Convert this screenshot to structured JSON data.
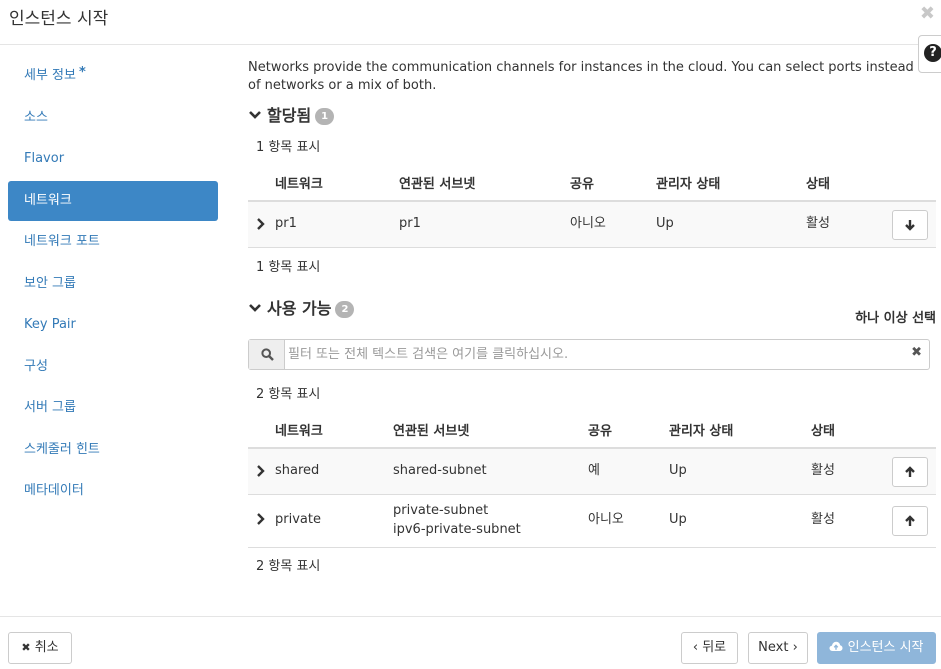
{
  "modal": {
    "title": "인스턴스 시작",
    "close_icon": "close-icon",
    "help_glyph": "?"
  },
  "sidebar": {
    "items": [
      {
        "label": "세부 정보",
        "required": "*"
      },
      {
        "label": "소스"
      },
      {
        "label": "Flavor"
      },
      {
        "label": "네트워크",
        "active": true
      },
      {
        "label": "네트워크 포트"
      },
      {
        "label": "보안 그룹"
      },
      {
        "label": "Key Pair"
      },
      {
        "label": "구성"
      },
      {
        "label": "서버 그룹"
      },
      {
        "label": "스케줄러 힌트"
      },
      {
        "label": "메타데이터"
      }
    ]
  },
  "description": "Networks provide the communication channels for instances in the cloud. You can select ports instead of networks or a mix of both.",
  "allocated": {
    "title": "할당됨",
    "badge": "1",
    "count_top": "1 항목 표시",
    "count_bottom": "1 항목 표시",
    "columns": [
      "네트워크",
      "연관된 서브넷",
      "공유",
      "관리자 상태",
      "상태"
    ],
    "rows": [
      {
        "network": "pr1",
        "subnets": [
          "pr1"
        ],
        "shared": "아니오",
        "admin_state": "Up",
        "status": "활성"
      }
    ]
  },
  "available": {
    "title": "사용 가능",
    "badge": "2",
    "select_hint": "하나 이상 선택",
    "search_placeholder": "필터 또는 전체 텍스트 검색은 여기를 클릭하십시오.",
    "count_top": "2 항목 표시",
    "count_bottom": "2 항목 표시",
    "columns": [
      "네트워크",
      "연관된 서브넷",
      "공유",
      "관리자 상태",
      "상태"
    ],
    "rows": [
      {
        "network": "shared",
        "subnets": [
          "shared-subnet"
        ],
        "shared": "예",
        "admin_state": "Up",
        "status": "활성"
      },
      {
        "network": "private",
        "subnets": [
          "private-subnet",
          "ipv6-private-subnet"
        ],
        "shared": "아니오",
        "admin_state": "Up",
        "status": "활성"
      }
    ]
  },
  "footer": {
    "cancel": "취소",
    "back": "뒤로",
    "next": "Next",
    "launch": "인스턴스 시작"
  },
  "colors": {
    "link": "#337ab7",
    "active_nav": "#3d87c6",
    "primary_disabled": "#8fb6da",
    "badge": "#b4b4b4"
  }
}
